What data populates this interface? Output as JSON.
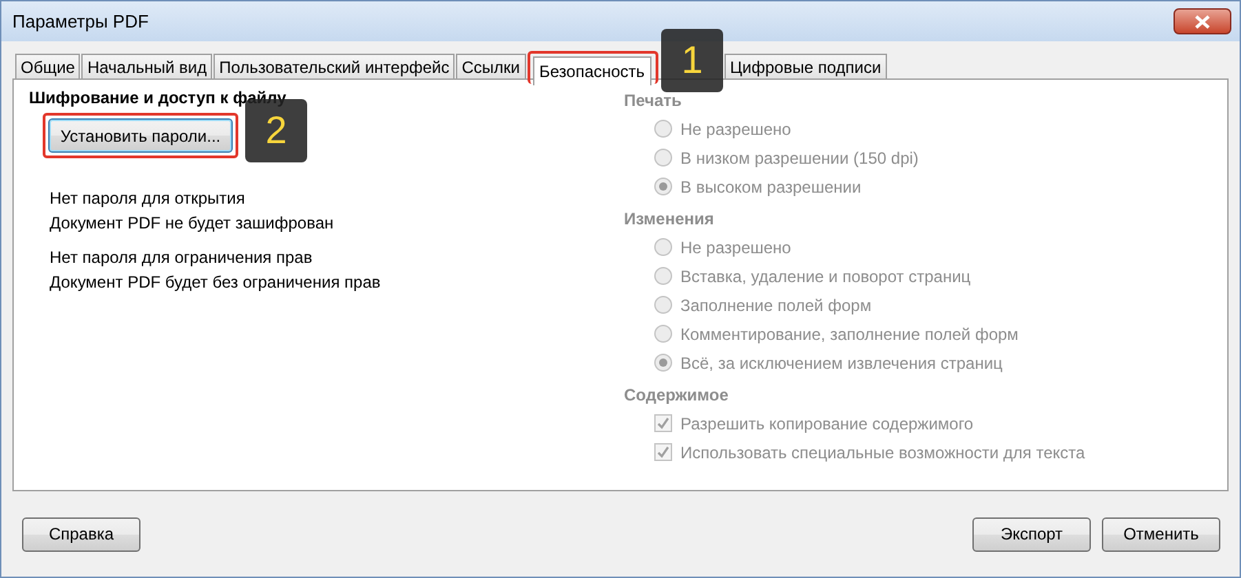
{
  "window": {
    "title": "Параметры PDF"
  },
  "tabs": [
    {
      "label": "Общие",
      "selected": false,
      "highlighted": false
    },
    {
      "label": "Начальный вид",
      "selected": false,
      "highlighted": false
    },
    {
      "label": "Пользовательский интерфейс",
      "selected": false,
      "highlighted": false
    },
    {
      "label": "Ссылки",
      "selected": false,
      "highlighted": false
    },
    {
      "label": "Безопасность",
      "selected": true,
      "highlighted": true,
      "callout": "1"
    },
    {
      "label": "Цифровые подписи",
      "selected": false,
      "highlighted": false
    }
  ],
  "encryption": {
    "heading": "Шифрование и доступ к файлу",
    "button": {
      "label": "Установить пароли...",
      "highlighted": true,
      "callout": "2"
    },
    "notes": [
      [
        "Нет пароля для открытия",
        "Документ PDF не будет зашифрован"
      ],
      [
        "Нет пароля для ограничения прав",
        "Документ PDF будет без ограничения прав"
      ]
    ]
  },
  "groups": [
    {
      "heading": "Печать",
      "disabled": true,
      "options": [
        {
          "kind": "radio",
          "label": "Не разрешено",
          "selected": false
        },
        {
          "kind": "radio",
          "label": "В низком разрешении (150 dpi)",
          "selected": false
        },
        {
          "kind": "radio",
          "label": "В высоком разрешении",
          "selected": true
        }
      ]
    },
    {
      "heading": "Изменения",
      "disabled": true,
      "options": [
        {
          "kind": "radio",
          "label": "Не разрешено",
          "selected": false
        },
        {
          "kind": "radio",
          "label": "Вставка, удаление и поворот страниц",
          "selected": false
        },
        {
          "kind": "radio",
          "label": "Заполнение полей форм",
          "selected": false
        },
        {
          "kind": "radio",
          "label": "Комментирование, заполнение полей форм",
          "selected": false
        },
        {
          "kind": "radio",
          "label": "Всё, за исключением извлечения страниц",
          "selected": true
        }
      ]
    },
    {
      "heading": "Содержимое",
      "disabled": true,
      "options": [
        {
          "kind": "checkbox",
          "label": "Разрешить копирование содержимого",
          "checked": true
        },
        {
          "kind": "checkbox",
          "label": "Использовать специальные возможности для текста",
          "checked": true
        }
      ]
    }
  ],
  "buttons": [
    {
      "label": "Справка"
    },
    {
      "label": "Экспорт"
    },
    {
      "label": "Отменить"
    }
  ]
}
